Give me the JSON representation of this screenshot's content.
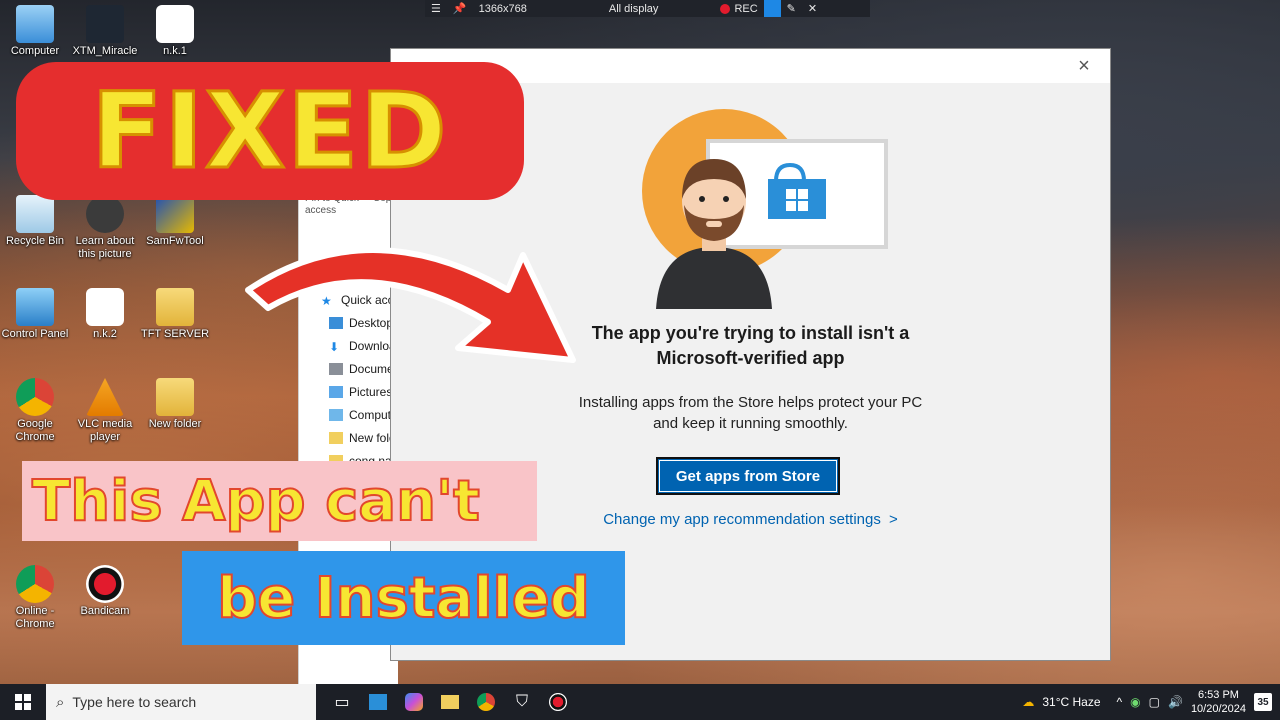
{
  "recorder": {
    "resolution": "1366x768",
    "mode": "All display",
    "rec_label": "REC"
  },
  "desktop_icons": [
    {
      "label": "Computer"
    },
    {
      "label": "XTM_Miracle"
    },
    {
      "label": "n.k.1"
    },
    {
      "label": "Recycle Bin"
    },
    {
      "label": "Learn about this picture"
    },
    {
      "label": "SamFwTool"
    },
    {
      "label": "Control Panel"
    },
    {
      "label": "n.k.2"
    },
    {
      "label": "TFT SERVER"
    },
    {
      "label": "Google Chrome"
    },
    {
      "label": "VLC media player"
    },
    {
      "label": "New folder"
    },
    {
      "label": "Online - Chrome"
    },
    {
      "label": "Bandicam"
    }
  ],
  "explorer": {
    "pin_label": "Pin to Quick access",
    "copy_label": "Cop",
    "nav_items": [
      {
        "label": "Quick acce"
      },
      {
        "label": "Desktop"
      },
      {
        "label": "Downloa"
      },
      {
        "label": "Docume"
      },
      {
        "label": "Pictures"
      },
      {
        "label": "Compute"
      },
      {
        "label": "New fold"
      },
      {
        "label": "cong nar"
      }
    ]
  },
  "dialog": {
    "heading_line1": "The app you're trying to install isn't a",
    "heading_line2": "Microsoft-verified app",
    "body_line1": "Installing apps from the Store helps protect your PC",
    "body_line2": "and keep it running smoothly.",
    "store_button": "Get apps from Store",
    "settings_link": "Change my app recommendation settings",
    "link_chevron": ">"
  },
  "overlays": {
    "fixed": "FIXED",
    "line1": "This App can't",
    "line2": "be Installed"
  },
  "taskbar": {
    "search_placeholder": "Type here to search",
    "weather": "31°C  Haze",
    "time": "6:53 PM",
    "date": "10/20/2024",
    "notifications": "35"
  },
  "colors": {
    "accent": "#0063b1",
    "banner_red": "#e52e2e",
    "title_yellow": "#f7e632",
    "installed_blue": "#2f96ea",
    "taskbar": "#1c1f26"
  }
}
